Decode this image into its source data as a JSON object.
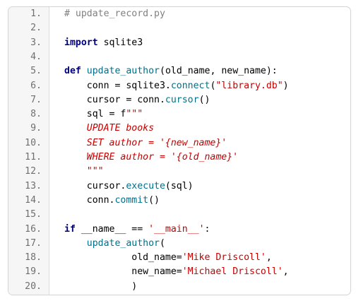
{
  "colors": {
    "keyword": "#000080",
    "function": "#00708a",
    "string": "#c80000",
    "comment": "#808080",
    "text": "#000000",
    "line_number": "#6f6f6f",
    "gutter_background": "#f6f6f6",
    "border": "#d4d4d4"
  },
  "code": {
    "language": "python",
    "lines": [
      {
        "number": "1.",
        "tokens": [
          {
            "t": "cm",
            "v": "# update_record.py"
          }
        ]
      },
      {
        "number": "2.",
        "tokens": []
      },
      {
        "number": "3.",
        "tokens": [
          {
            "t": "kw",
            "v": "import"
          },
          {
            "t": "tx",
            "v": " sqlite3"
          }
        ]
      },
      {
        "number": "4.",
        "tokens": []
      },
      {
        "number": "5.",
        "tokens": [
          {
            "t": "kw",
            "v": "def"
          },
          {
            "t": "tx",
            "v": " "
          },
          {
            "t": "fn",
            "v": "update_author"
          },
          {
            "t": "tx",
            "v": "(old_name, new_name):"
          }
        ]
      },
      {
        "number": "6.",
        "tokens": [
          {
            "t": "tx",
            "v": "    conn = sqlite3."
          },
          {
            "t": "fn",
            "v": "connect"
          },
          {
            "t": "tx",
            "v": "("
          },
          {
            "t": "str",
            "v": "\"library.db\""
          },
          {
            "t": "tx",
            "v": ")"
          }
        ]
      },
      {
        "number": "7.",
        "tokens": [
          {
            "t": "tx",
            "v": "    cursor = conn."
          },
          {
            "t": "fn",
            "v": "cursor"
          },
          {
            "t": "tx",
            "v": "()"
          }
        ]
      },
      {
        "number": "8.",
        "tokens": [
          {
            "t": "tx",
            "v": "    sql = f"
          },
          {
            "t": "str",
            "v": "\"\"\""
          }
        ]
      },
      {
        "number": "9.",
        "tokens": [
          {
            "t": "str-it",
            "v": "    UPDATE books"
          }
        ]
      },
      {
        "number": "10.",
        "tokens": [
          {
            "t": "str-it",
            "v": "    SET author = '{new_name}'"
          }
        ]
      },
      {
        "number": "11.",
        "tokens": [
          {
            "t": "str-it",
            "v": "    WHERE author = '{old_name}'"
          }
        ]
      },
      {
        "number": "12.",
        "tokens": [
          {
            "t": "str-it",
            "v": "    \"\"\""
          }
        ]
      },
      {
        "number": "13.",
        "tokens": [
          {
            "t": "tx",
            "v": "    cursor."
          },
          {
            "t": "fn",
            "v": "execute"
          },
          {
            "t": "tx",
            "v": "(sql)"
          }
        ]
      },
      {
        "number": "14.",
        "tokens": [
          {
            "t": "tx",
            "v": "    conn."
          },
          {
            "t": "fn",
            "v": "commit"
          },
          {
            "t": "tx",
            "v": "()"
          }
        ]
      },
      {
        "number": "15.",
        "tokens": []
      },
      {
        "number": "16.",
        "tokens": [
          {
            "t": "kw",
            "v": "if"
          },
          {
            "t": "tx",
            "v": " __name__ == "
          },
          {
            "t": "str",
            "v": "'__main__'"
          },
          {
            "t": "tx",
            "v": ":"
          }
        ]
      },
      {
        "number": "17.",
        "tokens": [
          {
            "t": "tx",
            "v": "    "
          },
          {
            "t": "fn",
            "v": "update_author"
          },
          {
            "t": "tx",
            "v": "("
          }
        ]
      },
      {
        "number": "18.",
        "tokens": [
          {
            "t": "tx",
            "v": "            old_name="
          },
          {
            "t": "str",
            "v": "'Mike Driscoll'"
          },
          {
            "t": "tx",
            "v": ","
          }
        ]
      },
      {
        "number": "19.",
        "tokens": [
          {
            "t": "tx",
            "v": "            new_name="
          },
          {
            "t": "str",
            "v": "'Michael Driscoll'"
          },
          {
            "t": "tx",
            "v": ","
          }
        ]
      },
      {
        "number": "20.",
        "tokens": [
          {
            "t": "tx",
            "v": "            )"
          }
        ]
      }
    ]
  }
}
